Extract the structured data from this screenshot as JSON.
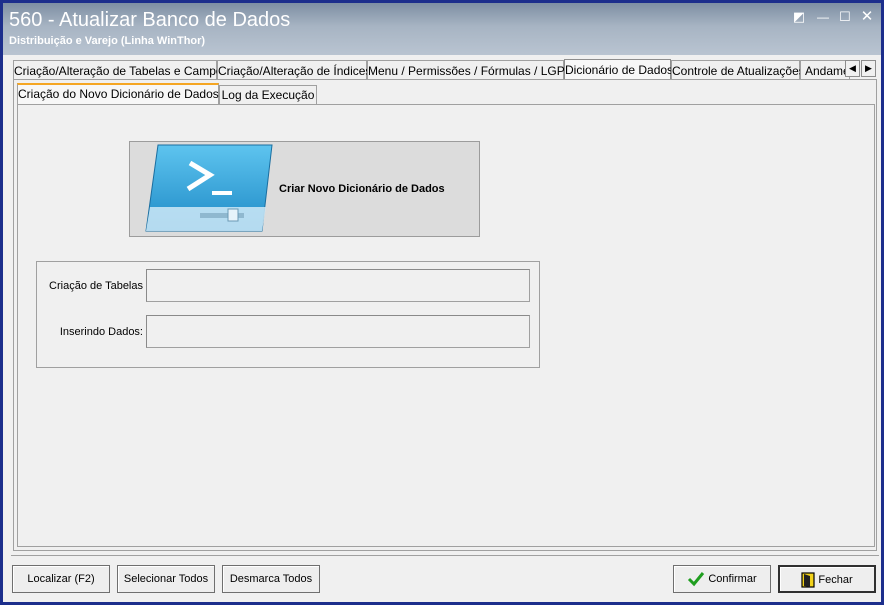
{
  "window": {
    "title": "560 - Atualizar Banco de Dados",
    "subtitle": "Distribuição e Varejo (Linha WinThor)",
    "controls": {
      "restore": "◩",
      "minimize": "—",
      "maximize": "☐",
      "close": "✕"
    }
  },
  "main_tabs": [
    {
      "label": "Criação/Alteração de Tabelas e Campos",
      "active": false
    },
    {
      "label": "Criação/Alteração de Índices",
      "active": false
    },
    {
      "label": "Menu / Permissões / Fórmulas / LGPD",
      "active": false
    },
    {
      "label": "Dicionário de Dados",
      "active": true
    },
    {
      "label": "Controle de Atualizações",
      "active": false
    },
    {
      "label": "Andame",
      "active": false
    }
  ],
  "tab_scroll": {
    "left": "◀",
    "right": "▶"
  },
  "sub_tabs": [
    {
      "label": "Criação do Novo Dicionário de Dados",
      "active": true
    },
    {
      "label": "Log da Execução",
      "active": false
    }
  ],
  "create_button": {
    "label": "Criar Novo Dicionário de Dados",
    "icon": "console-icon"
  },
  "progress": {
    "tables_label": "Criação de Tabelas",
    "tables_value": "",
    "data_label": "Inserindo Dados:",
    "data_value": ""
  },
  "footer_buttons": {
    "find": "Localizar (F2)",
    "select_all": "Selecionar Todos",
    "deselect_all": "Desmarca Todos",
    "confirm": "Confirmar",
    "close": "Fechar"
  },
  "colors": {
    "title_gradient_top": "#7e8fa3",
    "window_border": "#1c2e8c",
    "active_subtab_accent": "#f5a623",
    "confirm_check": "#1f9e1f"
  }
}
